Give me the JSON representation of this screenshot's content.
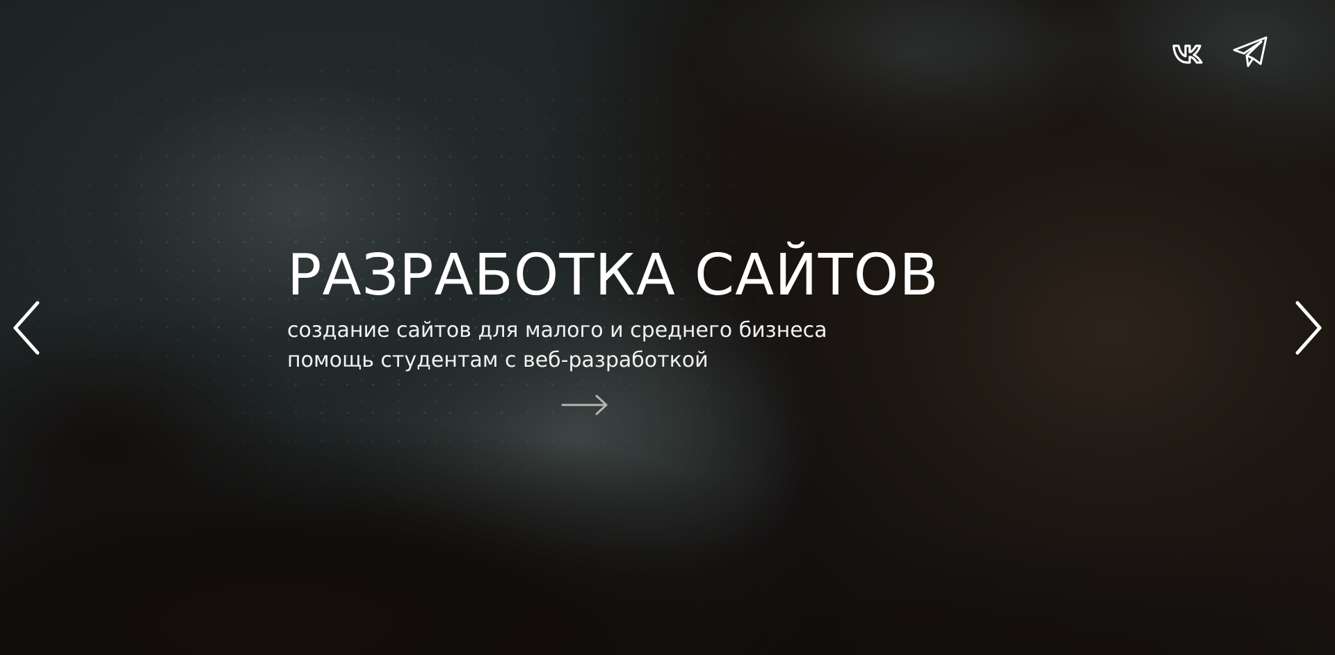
{
  "hero": {
    "title": "РАЗРАБОТКА САЙТОВ",
    "subtitle_line1": "создание сайтов для малого и среднего бизнеса",
    "subtitle_line2": "помощь студентам с веб-разработкой"
  },
  "social": {
    "items": [
      {
        "name": "vk",
        "icon": "vk-icon"
      },
      {
        "name": "telegram",
        "icon": "telegram-icon"
      }
    ]
  },
  "colors": {
    "text": "#ffffff",
    "arrow": "#ffffff",
    "go_arrow": "#b5b5b5"
  }
}
